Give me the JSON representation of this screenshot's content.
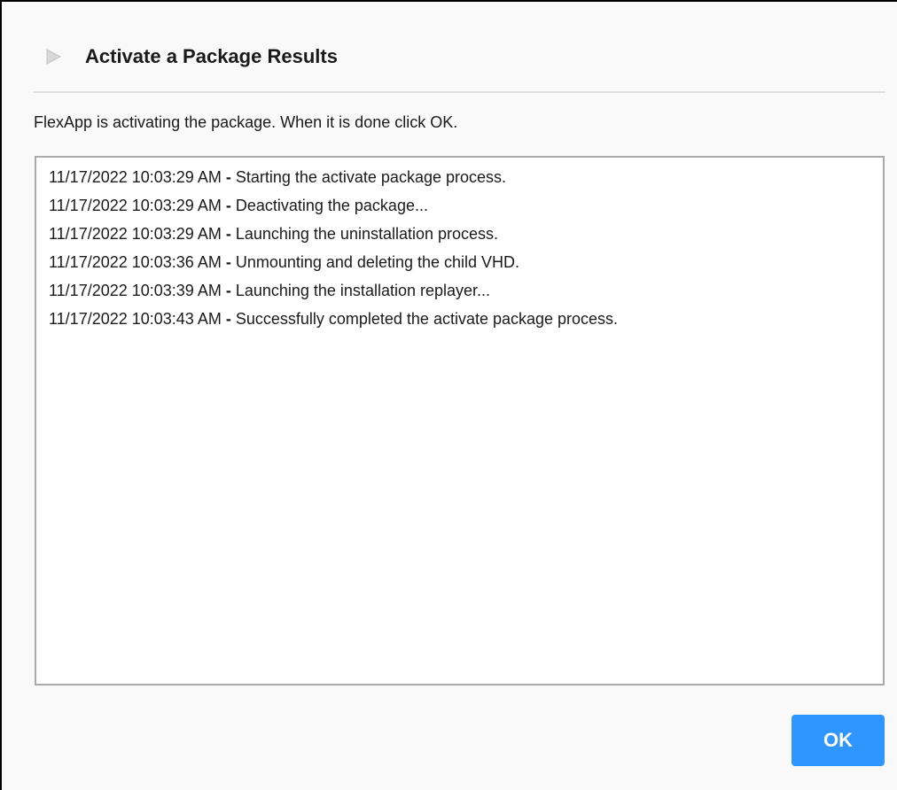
{
  "dialog": {
    "title": "Activate a Package Results",
    "message": "FlexApp is activating the package. When it is done click OK.",
    "icon": "play-triangle-icon"
  },
  "log": {
    "separator": " - ",
    "entries": [
      {
        "timestamp": "11/17/2022 10:03:29 AM",
        "text": "Starting the activate package process."
      },
      {
        "timestamp": "11/17/2022 10:03:29 AM",
        "text": "Deactivating the package..."
      },
      {
        "timestamp": "11/17/2022 10:03:29 AM",
        "text": "Launching the uninstallation process."
      },
      {
        "timestamp": "11/17/2022 10:03:36 AM",
        "text": "Unmounting and deleting the child VHD."
      },
      {
        "timestamp": "11/17/2022 10:03:39 AM",
        "text": "Launching the installation replayer..."
      },
      {
        "timestamp": "11/17/2022 10:03:43 AM",
        "text": "Successfully completed the activate package process."
      }
    ]
  },
  "actions": {
    "ok_label": "OK"
  },
  "colors": {
    "accent": "#2f95ff",
    "icon_gray": "#d8d8d8"
  }
}
